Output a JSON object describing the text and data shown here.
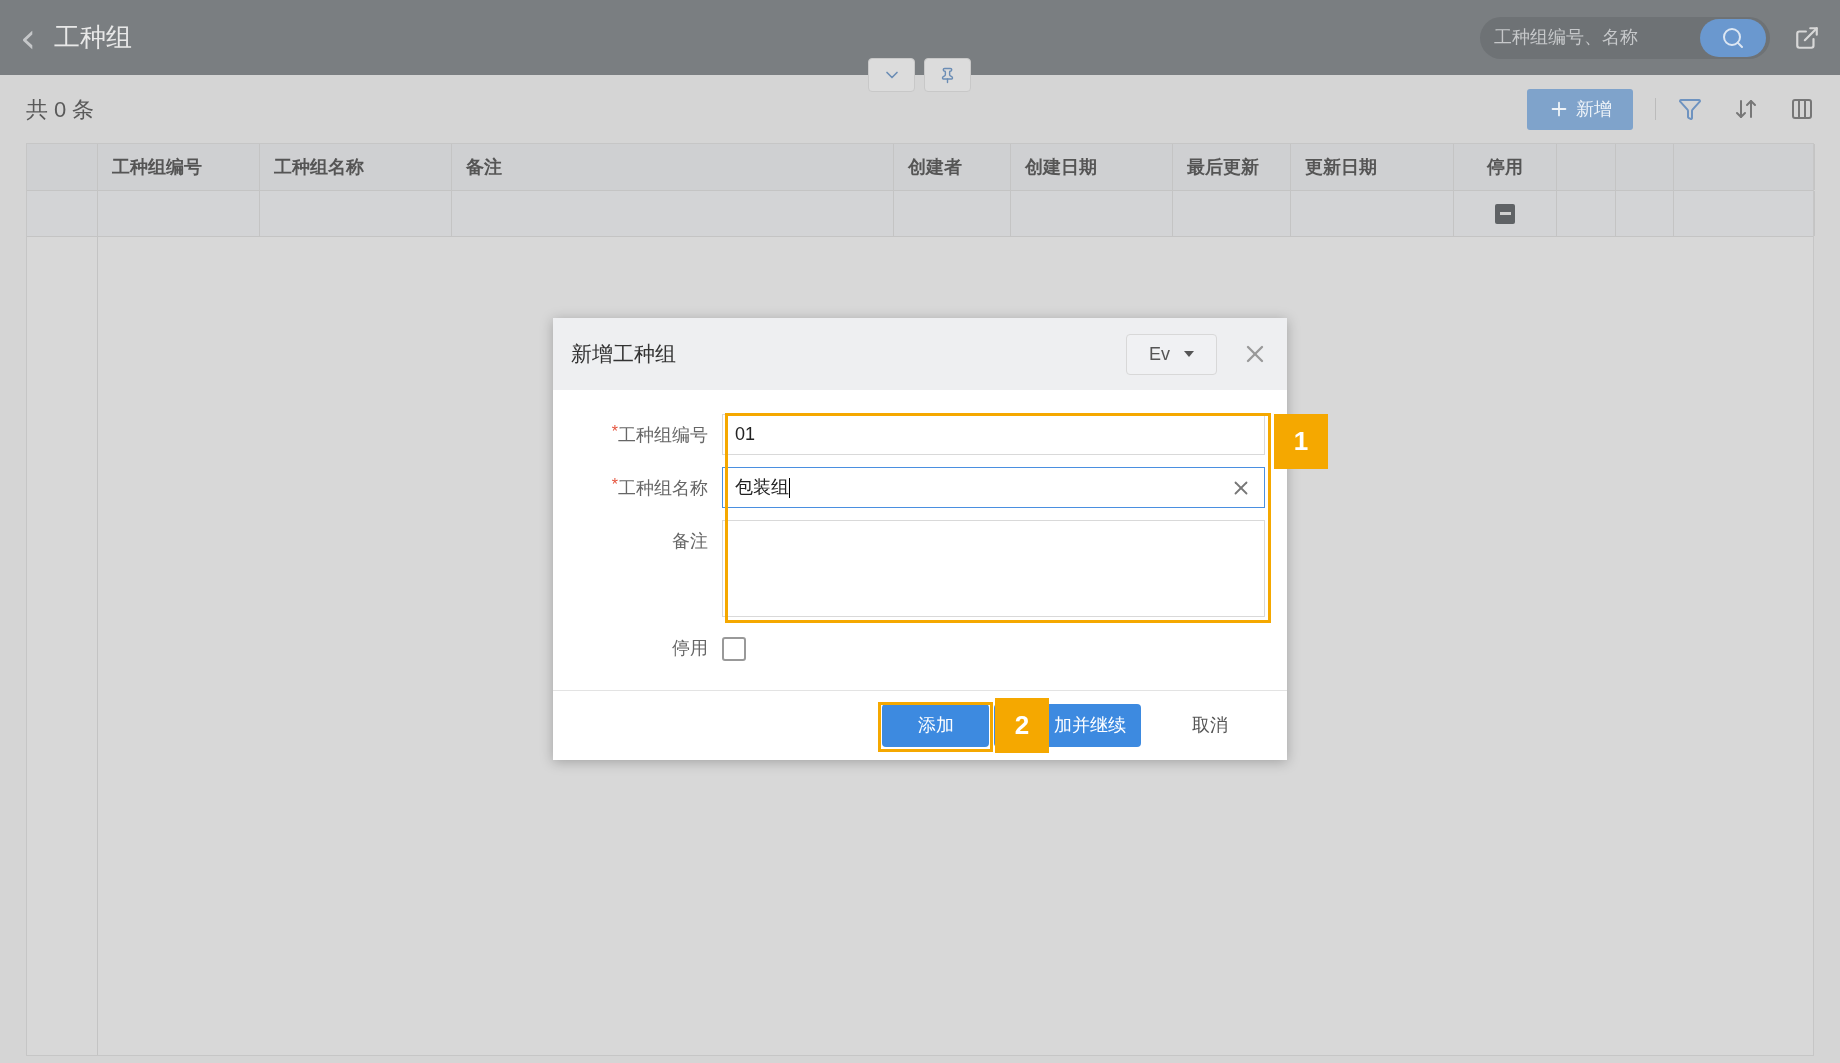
{
  "header": {
    "back": "‹",
    "title": "工种组",
    "search": {
      "placeholder": "工种组编号、名称"
    }
  },
  "toolbar": {
    "count": "共 0 条",
    "add_button": "新增"
  },
  "table": {
    "columns": [
      "",
      "工种组编号",
      "工种组名称",
      "备注",
      "创建者",
      "创建日期",
      "最后更新",
      "更新日期",
      "停用",
      "",
      "",
      ""
    ],
    "filter_row": {
      "disabled_filter_indeterminate": true
    }
  },
  "dialog": {
    "title": "新增工种组",
    "language": "Ev",
    "fields": [
      {
        "kind": "text",
        "label": "工种组编号",
        "required_mark": "*",
        "value": "01",
        "focused": false
      },
      {
        "kind": "text",
        "label": "工种组名称",
        "required_mark": "*",
        "value": "包装组",
        "focused": true
      },
      {
        "kind": "textarea",
        "label": "备注",
        "focused": false
      },
      {
        "kind": "checkbox",
        "label": "停用",
        "checked": false
      }
    ],
    "buttons": [
      {
        "label": "添加",
        "primary": true
      },
      {
        "label": "加并继续",
        "primary": true
      },
      {
        "label": "取消",
        "primary": false
      }
    ]
  },
  "annotations": [
    {
      "label": "1"
    },
    {
      "label": "2"
    }
  ]
}
